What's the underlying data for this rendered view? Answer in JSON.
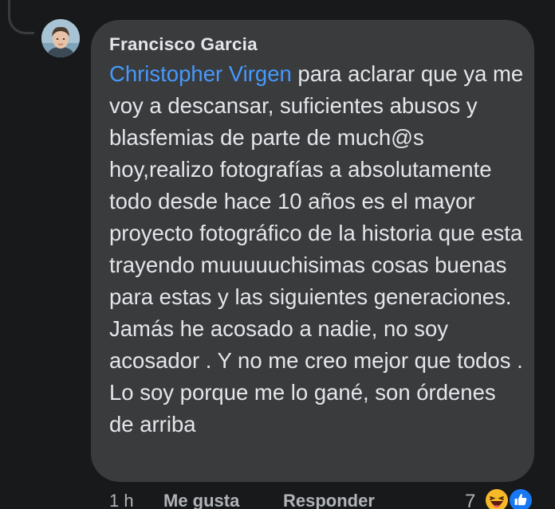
{
  "comment": {
    "author": "Francisco Garcia",
    "mention": "Christopher Virgen",
    "text": " para aclarar que ya me voy a descansar, suficientes abusos y blasfemias de parte de much@s hoy,realizo fotografías a absolutamente todo desde hace 10 años es el mayor proyecto fotográfico de la historia que esta trayendo muuuuuchisimas cosas buenas para estas y las siguientes generaciones. Jamás he acosado a nadie, no soy acosador . Y no me creo mejor que todos . Lo soy porque me lo gané, son órdenes de arriba"
  },
  "actions": {
    "time": "1 h",
    "like_label": "Me gusta",
    "reply_label": "Responder"
  },
  "reactions": {
    "count": "7",
    "icons": [
      "haha-icon",
      "like-icon"
    ]
  },
  "colors": {
    "background": "#18191a",
    "bubble": "#3a3b3c",
    "text": "#e4e6eb",
    "mention": "#4599ff",
    "secondary": "#b0b3b8",
    "like_blue": "#1877f2",
    "haha_yellow": "#f7b928"
  }
}
